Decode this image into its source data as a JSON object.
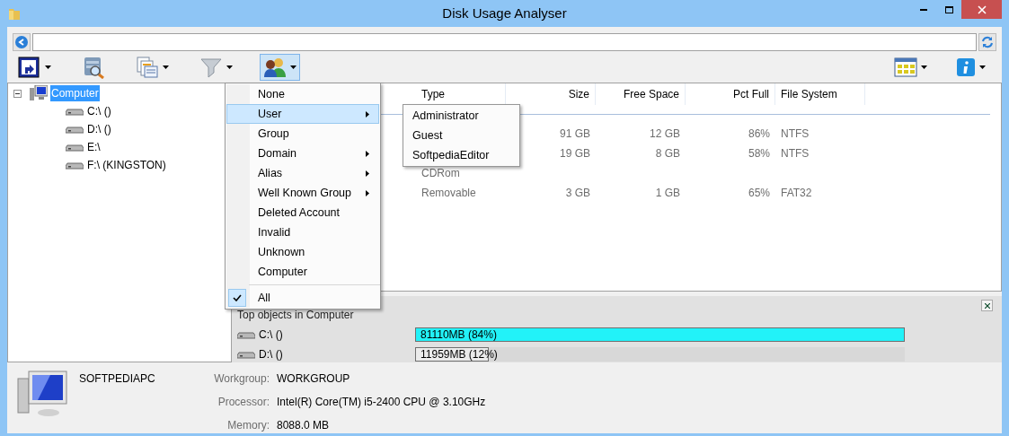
{
  "window": {
    "title": "Disk Usage Analyser"
  },
  "toolbar": [
    {
      "kind": "shortcut",
      "dropdown": true,
      "pressed": false
    },
    {
      "kind": "scan",
      "dropdown": false,
      "pressed": false
    },
    {
      "kind": "report",
      "dropdown": true,
      "pressed": false
    },
    {
      "kind": "filter",
      "dropdown": true,
      "pressed": false
    },
    {
      "kind": "users",
      "dropdown": true,
      "pressed": true
    }
  ],
  "toolbar_right": [
    {
      "kind": "view",
      "dropdown": true,
      "pressed": false
    },
    {
      "kind": "info",
      "dropdown": true,
      "pressed": false
    }
  ],
  "tree": [
    {
      "label": "Computer",
      "selected": true,
      "expanded": true,
      "children": [
        {
          "label": "C:\\ ()",
          "selected": false
        },
        {
          "label": "D:\\ ()",
          "selected": false
        },
        {
          "label": "E:\\",
          "selected": false
        },
        {
          "label": "F:\\ (KINGSTON)",
          "selected": false
        }
      ]
    }
  ],
  "table": {
    "columns": [
      "Type",
      "Size",
      "Free Space",
      "Pct Full",
      "File System"
    ],
    "rows": [
      [
        null,
        "91 GB",
        "12 GB",
        "86%",
        "NTFS"
      ],
      [
        null,
        "19 GB",
        "8 GB",
        "58%",
        "NTFS"
      ],
      [
        "CDRom",
        null,
        null,
        null,
        null
      ],
      [
        "Removable",
        "3 GB",
        "1 GB",
        "65%",
        "FAT32"
      ]
    ]
  },
  "menu": {
    "items": [
      {
        "kind": "item",
        "label": "None",
        "selected": false,
        "submenu": false,
        "checked": false
      },
      {
        "kind": "item",
        "label": "User",
        "selected": true,
        "submenu": true,
        "checked": false
      },
      {
        "kind": "item",
        "label": "Group",
        "selected": false,
        "submenu": false,
        "checked": false
      },
      {
        "kind": "item",
        "label": "Domain",
        "selected": false,
        "submenu": true,
        "checked": false
      },
      {
        "kind": "item",
        "label": "Alias",
        "selected": false,
        "submenu": true,
        "checked": false
      },
      {
        "kind": "item",
        "label": "Well Known Group",
        "selected": false,
        "submenu": true,
        "checked": false
      },
      {
        "kind": "item",
        "label": "Deleted Account",
        "selected": false,
        "submenu": false,
        "checked": false
      },
      {
        "kind": "item",
        "label": "Invalid",
        "selected": false,
        "submenu": false,
        "checked": false
      },
      {
        "kind": "item",
        "label": "Unknown",
        "selected": false,
        "submenu": false,
        "checked": false
      },
      {
        "kind": "item",
        "label": "Computer",
        "selected": false,
        "submenu": false,
        "checked": false
      },
      {
        "kind": "separator"
      },
      {
        "kind": "item",
        "label": "All",
        "selected": false,
        "submenu": false,
        "checked": true
      }
    ],
    "submenu": [
      "Administrator",
      "Guest",
      "SoftpediaEditor"
    ]
  },
  "top_objects": {
    "title": "Top objects in Computer",
    "items": [
      {
        "label": "C:\\ ()",
        "bar_text": "81110MB (84%)",
        "level": 1,
        "color": "#22f2f8"
      },
      {
        "label": "D:\\ ()",
        "bar_text": "11959MB (12%)",
        "level": 0.15,
        "color": "#ebebeb"
      }
    ]
  },
  "computer_info": {
    "name": "SOFTPEDIAPC",
    "fields": [
      {
        "label": "Workgroup:",
        "value": "WORKGROUP"
      },
      {
        "label": "Processor:",
        "value": "Intel(R) Core(TM) i5-2400 CPU @ 3.10GHz"
      },
      {
        "label": "Memory:",
        "value": "8088.0 MB"
      }
    ]
  }
}
